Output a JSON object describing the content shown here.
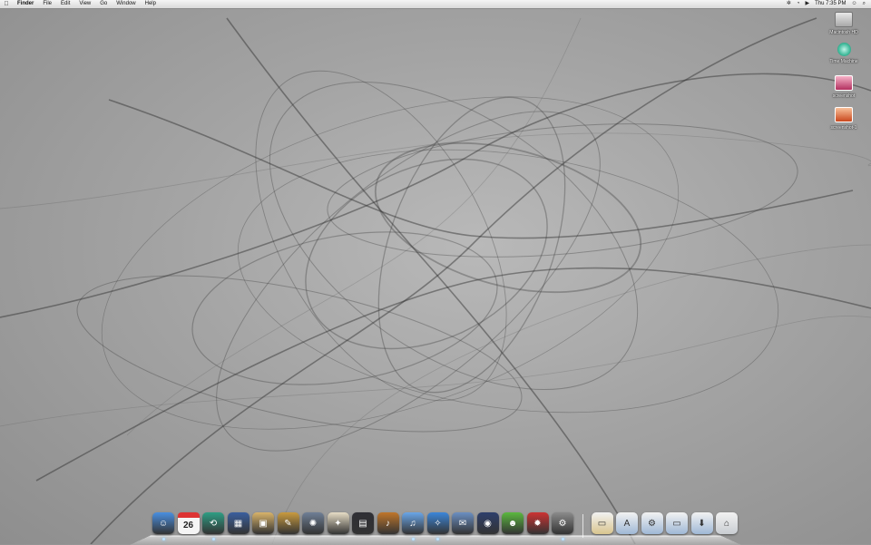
{
  "menubar": {
    "apple": "",
    "app_name": "Finder",
    "items": [
      "File",
      "Edit",
      "View",
      "Go",
      "Window",
      "Help"
    ],
    "status": {
      "bluetooth": "✲",
      "wifi": "◔",
      "volume": "▶",
      "clock": "Thu 7:35 PM",
      "user": "☺",
      "spotlight": "⌕"
    }
  },
  "desktop_icons": [
    {
      "label": "Macintosh HD",
      "icon": "hard-drive-icon"
    },
    {
      "label": "Time Machine",
      "icon": "time-machine-icon"
    },
    {
      "label": "screenshot",
      "icon": "image-file-icon"
    },
    {
      "label": "screenshot-1",
      "icon": "image-file-icon"
    }
  ],
  "dock": {
    "calendar_day": "26",
    "apps": [
      {
        "name": "Finder",
        "icon": "finder-icon",
        "color": "#4a8fe0",
        "glyph": "☺"
      },
      {
        "name": "iCal",
        "icon": "calendar-icon",
        "color": "#f2f2f2",
        "glyph": ""
      },
      {
        "name": "Time Machine",
        "icon": "time-machine-icon",
        "color": "#2e9e84",
        "glyph": "⟲"
      },
      {
        "name": "Spaces",
        "icon": "spaces-icon",
        "color": "#3b5f9e",
        "glyph": "▦"
      },
      {
        "name": "iPhoto",
        "icon": "iphoto-icon",
        "color": "#d8b36a",
        "glyph": "▣"
      },
      {
        "name": "Preview",
        "icon": "preview-icon",
        "color": "#c99b3f",
        "glyph": "✎"
      },
      {
        "name": "Aperture",
        "icon": "aperture-icon",
        "color": "#6f7f96",
        "glyph": "✺"
      },
      {
        "name": "Automator",
        "icon": "automator-icon",
        "color": "#e7ddc6",
        "glyph": "✦"
      },
      {
        "name": "Front Row",
        "icon": "front-row-icon",
        "color": "#2f2f35",
        "glyph": "▤"
      },
      {
        "name": "GarageBand",
        "icon": "garageband-icon",
        "color": "#c0762b",
        "glyph": "♪"
      },
      {
        "name": "iTunes",
        "icon": "itunes-icon",
        "color": "#6aa6e8",
        "glyph": "♫"
      },
      {
        "name": "Safari",
        "icon": "safari-icon",
        "color": "#3c86d9",
        "glyph": "✧"
      },
      {
        "name": "Mail",
        "icon": "mail-icon",
        "color": "#6b8fc2",
        "glyph": "✉"
      },
      {
        "name": "Dashboard",
        "icon": "dashboard-icon",
        "color": "#2e3f6b",
        "glyph": "◉"
      },
      {
        "name": "iChat",
        "icon": "ichat-icon",
        "color": "#5bb83f",
        "glyph": "☻"
      },
      {
        "name": "Photo Booth",
        "icon": "photobooth-icon",
        "color": "#c33",
        "glyph": "✹"
      },
      {
        "name": "System Preferences",
        "icon": "system-preferences-icon",
        "color": "#8b8b8b",
        "glyph": "⚙"
      }
    ],
    "stacks": [
      {
        "name": "Documents",
        "icon": "documents-stack-icon",
        "color": "#d9c58f",
        "glyph": "▭"
      },
      {
        "name": "Applications",
        "icon": "applications-folder-icon",
        "color": "#9fb8d6",
        "glyph": "A"
      },
      {
        "name": "Utilities",
        "icon": "utilities-folder-icon",
        "color": "#9fb8d6",
        "glyph": "⚙"
      },
      {
        "name": "Desktop",
        "icon": "desktop-folder-icon",
        "color": "#9fb8d6",
        "glyph": "▭"
      },
      {
        "name": "Downloads",
        "icon": "downloads-folder-icon",
        "color": "#9fb8d6",
        "glyph": "⬇"
      },
      {
        "name": "Trash",
        "icon": "trash-icon",
        "color": "#c9cdd2",
        "glyph": "⌂"
      }
    ]
  }
}
